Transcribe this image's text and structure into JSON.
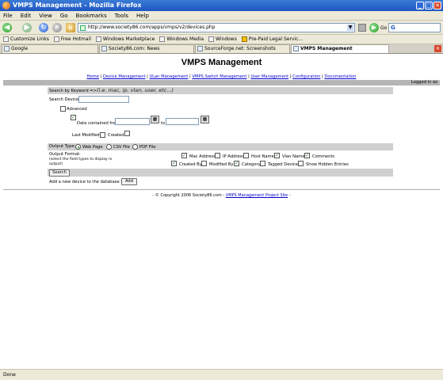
{
  "window": {
    "title": "VMPS Management - Mozilla Firefox"
  },
  "menu": {
    "items": [
      "File",
      "Edit",
      "View",
      "Go",
      "Bookmarks",
      "Tools",
      "Help"
    ]
  },
  "toolbar": {
    "url": "http://www.society86.com/apps/vmps/v2/devices.php",
    "go_label": "Go"
  },
  "bookmarks": [
    "Customize Links",
    "Free Hotmail",
    "Windows Marketplace",
    "Windows Media",
    "Windows",
    "Pre-Paid Legal Servic..."
  ],
  "tabs": [
    "Google",
    "Society86.com: News",
    "SourceForge.net: Screenshots",
    "VMPS Management"
  ],
  "page": {
    "title": "VMPS Management",
    "nav": [
      "Home",
      "Device Management",
      "VLan Management",
      "VMPS Switch Management",
      "User Management",
      "Configuration",
      "Documentation"
    ],
    "logged_in": "Logged in as",
    "search": {
      "bar_label": "Search by Keyword =>",
      "bar_hint": "(i.e. mac, ip, vlan, user, etc...)",
      "devices_label": "Search Devices:",
      "devices_value": "",
      "advanced_label": "Advanced",
      "date_label": "Date contained from",
      "to_label": "to",
      "date_from": "",
      "date_to": "",
      "last_modified_label": "Last Modified",
      "created_label": "Created"
    },
    "output": {
      "type_label": "Output Type:",
      "types": [
        "Web Page",
        "CSV File",
        "PDF File"
      ],
      "format_label": "Output Format:",
      "format_hint": "(select the field types to display in output)",
      "fields": [
        {
          "label": "Mac Address",
          "checked": true
        },
        {
          "label": "IP Address",
          "checked": false
        },
        {
          "label": "Host Name",
          "checked": false
        },
        {
          "label": "Vlan Name",
          "checked": true
        },
        {
          "label": "Comments",
          "checked": true
        },
        {
          "label": "Created By",
          "checked": true
        },
        {
          "label": "Modified By",
          "checked": false
        },
        {
          "label": "Category",
          "checked": true
        },
        {
          "label": "Tagged Device",
          "checked": false
        },
        {
          "label": "Show Hidden Entries",
          "checked": false
        }
      ],
      "search_button": "Search"
    },
    "add": {
      "text": "Add a new device to the database =>",
      "button": "Add"
    },
    "footer": {
      "copyright": "- © Copyright 2006 Society86.com -",
      "project_link": "VMPS Management Project Site",
      "suffix": "-"
    }
  },
  "status": {
    "text": "Done"
  }
}
